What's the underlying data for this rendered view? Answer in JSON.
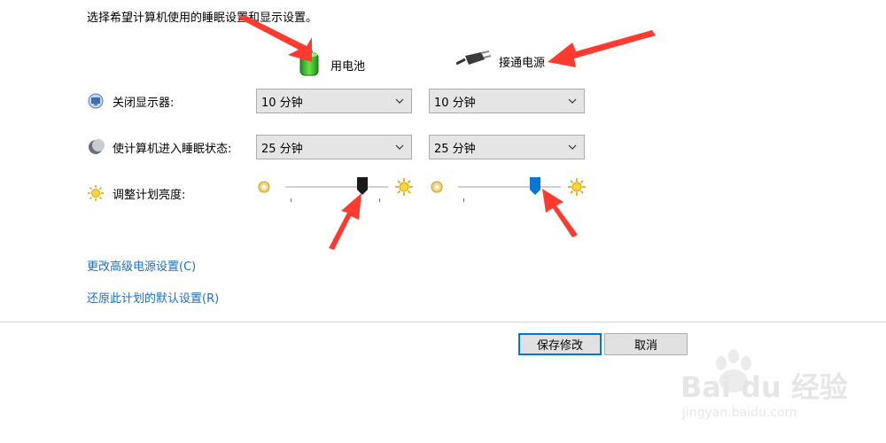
{
  "intro": "选择希望计算机使用的睡眠设置和显示设置。",
  "columns": {
    "battery": {
      "label": "用电池",
      "icon": "battery-icon"
    },
    "plugged": {
      "label": "接通电源",
      "icon": "power-plug-icon"
    }
  },
  "rows": {
    "display": {
      "label": "关闭显示器:",
      "icon": "monitor-icon",
      "battery_value": "10 分钟",
      "plugged_value": "10 分钟"
    },
    "sleep": {
      "label": "使计算机进入睡眠状态:",
      "icon": "moon-icon",
      "battery_value": "25 分钟",
      "plugged_value": "25 分钟"
    },
    "brightness": {
      "label": "调整计划亮度:",
      "icon": "sun-icon",
      "battery_level": 0.75,
      "plugged_level": 0.75,
      "battery_thumb_color": "#1a1a1a",
      "plugged_thumb_color": "#0078d7"
    }
  },
  "links": {
    "advanced": "更改高级电源设置(C)",
    "restore": "还原此计划的默认设置(R)"
  },
  "buttons": {
    "save": "保存修改",
    "cancel": "取消"
  },
  "watermark": {
    "brand": "Bai du 经验",
    "url": "jingyan.baidu.com"
  },
  "colors": {
    "accent": "#0078d7",
    "link": "#1a6fc7",
    "annotation_arrow": "#ff3b30"
  }
}
